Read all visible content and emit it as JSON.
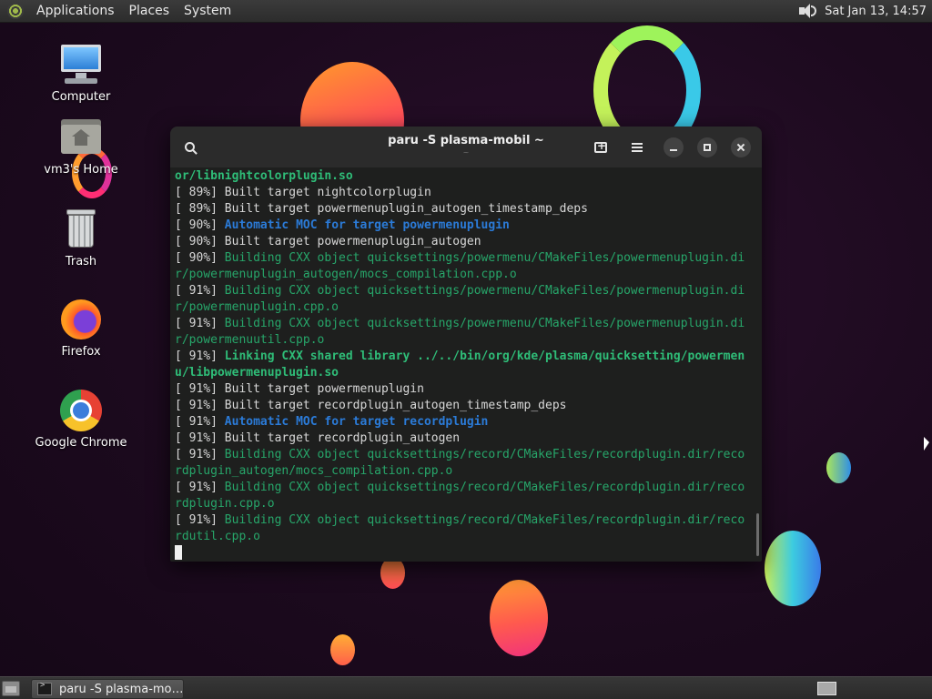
{
  "top_panel": {
    "menus": [
      "Applications",
      "Places",
      "System"
    ],
    "clock": "Sat Jan 13, 14:57",
    "icons": {
      "menu": "mate-logo-icon",
      "volume": "volume-icon"
    }
  },
  "desktop_icons": [
    {
      "label": "Computer",
      "icon": "computer-icon"
    },
    {
      "label": "vm3's Home",
      "icon": "home-folder-icon"
    },
    {
      "label": "Trash",
      "icon": "trash-icon"
    },
    {
      "label": "Firefox",
      "icon": "firefox-icon"
    },
    {
      "label": "Google Chrome",
      "icon": "chrome-icon"
    }
  ],
  "terminal": {
    "title": "paru -S plasma-mobil ~",
    "subtitle": "~",
    "lines": [
      {
        "prefix": "",
        "text": "or/libnightcolorplugin.so",
        "style": "green-b"
      },
      {
        "prefix": "[ 89%] ",
        "text": "Built target nightcolorplugin",
        "style": "plain"
      },
      {
        "prefix": "[ 89%] ",
        "text": "Built target powermenuplugin_autogen_timestamp_deps",
        "style": "plain"
      },
      {
        "prefix": "[ 90%] ",
        "text": "Automatic MOC for target powermenuplugin",
        "style": "blue-b"
      },
      {
        "prefix": "[ 90%] ",
        "text": "Built target powermenuplugin_autogen",
        "style": "plain"
      },
      {
        "prefix": "[ 90%] ",
        "text": "Building CXX object quicksettings/powermenu/CMakeFiles/powermenuplugin.di",
        "style": "green"
      },
      {
        "prefix": "",
        "text": "r/powermenuplugin_autogen/mocs_compilation.cpp.o",
        "style": "green"
      },
      {
        "prefix": "[ 91%] ",
        "text": "Building CXX object quicksettings/powermenu/CMakeFiles/powermenuplugin.di",
        "style": "green"
      },
      {
        "prefix": "",
        "text": "r/powermenuplugin.cpp.o",
        "style": "green"
      },
      {
        "prefix": "[ 91%] ",
        "text": "Building CXX object quicksettings/powermenu/CMakeFiles/powermenuplugin.di",
        "style": "green"
      },
      {
        "prefix": "",
        "text": "r/powermenuutil.cpp.o",
        "style": "green"
      },
      {
        "prefix": "[ 91%] ",
        "text": "Linking CXX shared library ../../bin/org/kde/plasma/quicksetting/powermen",
        "style": "green-b"
      },
      {
        "prefix": "",
        "text": "u/libpowermenuplugin.so",
        "style": "green-b"
      },
      {
        "prefix": "[ 91%] ",
        "text": "Built target powermenuplugin",
        "style": "plain"
      },
      {
        "prefix": "[ 91%] ",
        "text": "Built target recordplugin_autogen_timestamp_deps",
        "style": "plain"
      },
      {
        "prefix": "[ 91%] ",
        "text": "Automatic MOC for target recordplugin",
        "style": "blue-b"
      },
      {
        "prefix": "[ 91%] ",
        "text": "Built target recordplugin_autogen",
        "style": "plain"
      },
      {
        "prefix": "[ 91%] ",
        "text": "Building CXX object quicksettings/record/CMakeFiles/recordplugin.dir/reco",
        "style": "green"
      },
      {
        "prefix": "",
        "text": "rdplugin_autogen/mocs_compilation.cpp.o",
        "style": "green"
      },
      {
        "prefix": "[ 91%] ",
        "text": "Building CXX object quicksettings/record/CMakeFiles/recordplugin.dir/reco",
        "style": "green"
      },
      {
        "prefix": "",
        "text": "rdplugin.cpp.o",
        "style": "green"
      },
      {
        "prefix": "[ 91%] ",
        "text": "Building CXX object quicksettings/record/CMakeFiles/recordplugin.dir/reco",
        "style": "green"
      },
      {
        "prefix": "",
        "text": "rdutil.cpp.o",
        "style": "green"
      }
    ],
    "icons": {
      "search": "search-icon",
      "new_tab": "new-tab-icon",
      "menu": "hamburger-menu-icon",
      "minimize": "minimize-icon",
      "maximize": "maximize-icon",
      "close": "close-icon"
    }
  },
  "bottom_panel": {
    "task_label": "paru -S plasma-mo…",
    "icons": {
      "show_desktop": "show-desktop-icon",
      "task": "terminal-icon",
      "workspace": "workspace-switcher-icon"
    }
  },
  "colors": {
    "green": "#27a66a",
    "green_bold": "#2fbd78",
    "blue_bold": "#2b7bd8",
    "terminal_bg": "#1e1f1e",
    "header_bg": "#2b2b2b"
  }
}
